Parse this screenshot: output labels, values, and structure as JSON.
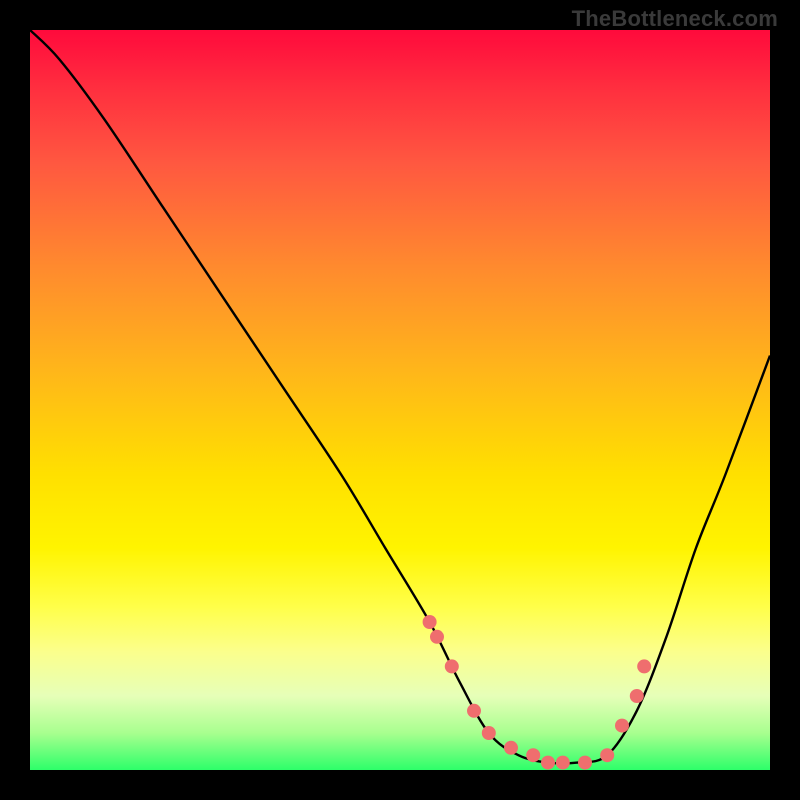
{
  "watermark": "TheBottleneck.com",
  "colors": {
    "frame_bg": "#000000",
    "marker_fill": "#ef6e6e",
    "curve_stroke": "#000000"
  },
  "chart_data": {
    "type": "line",
    "title": "",
    "xlabel": "",
    "ylabel": "",
    "xlim": [
      0,
      100
    ],
    "ylim": [
      0,
      100
    ],
    "grid": false,
    "legend": false,
    "series": [
      {
        "name": "bottleneck-curve",
        "x": [
          0,
          4,
          10,
          18,
          26,
          34,
          42,
          48,
          54,
          58,
          62,
          66,
          70,
          74,
          78,
          82,
          86,
          90,
          94,
          100
        ],
        "values": [
          100,
          96,
          88,
          76,
          64,
          52,
          40,
          30,
          20,
          12,
          5,
          2,
          1,
          1,
          2,
          8,
          18,
          30,
          40,
          56
        ]
      }
    ],
    "markers": {
      "name": "highlighted-points",
      "x": [
        54,
        55,
        57,
        60,
        62,
        65,
        68,
        70,
        72,
        75,
        78,
        80,
        82,
        83
      ],
      "values": [
        20,
        18,
        14,
        8,
        5,
        3,
        2,
        1,
        1,
        1,
        2,
        6,
        10,
        14
      ]
    }
  }
}
